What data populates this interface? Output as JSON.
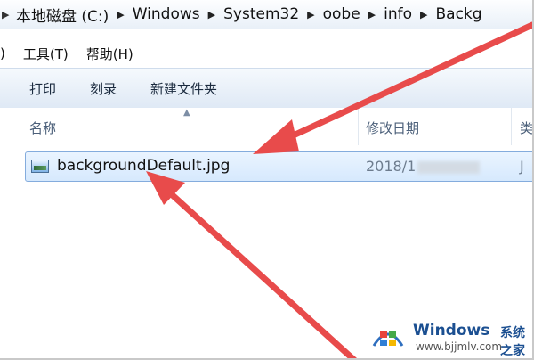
{
  "address_bar": {
    "crumbs": [
      "本地磁盘 (C:)",
      "Windows",
      "System32",
      "oobe",
      "info",
      "Backg"
    ]
  },
  "menubar": {
    "items": [
      ")",
      "工具(T)",
      "帮助(H)"
    ]
  },
  "toolbar": {
    "print": "打印",
    "burn": "刻录",
    "new_folder": "新建文件夹"
  },
  "columns": {
    "name": "名称",
    "date": "修改日期",
    "type": "类"
  },
  "files": [
    {
      "name": "backgroundDefault.jpg",
      "date": "2018/1",
      "type": "J"
    }
  ],
  "watermark": {
    "brand": "Windows",
    "cn": "系统之家",
    "url": "www.bjjmlv.com"
  },
  "colors": {
    "arrow": "#e84b4b",
    "selection": "#d6e9fd"
  }
}
